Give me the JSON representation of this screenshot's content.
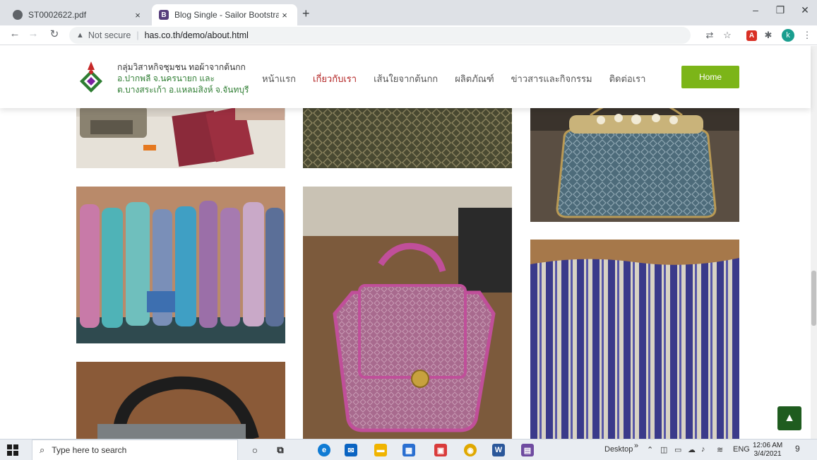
{
  "browser": {
    "tabs": [
      {
        "title": "ST0002622.pdf",
        "close": "×"
      },
      {
        "title": "Blog Single - Sailor Bootstrap Te",
        "close": "×"
      }
    ],
    "new_tab": "+",
    "window_controls": {
      "minimize": "–",
      "restore": "❐",
      "close": "✕"
    },
    "address": {
      "security": "Not secure",
      "url": "has.co.th/demo/about.html"
    },
    "profile_initial": "k"
  },
  "site": {
    "brand_lines": [
      "กลุ่มวิสาหกิจชุมชน ทอผ้าจากต้นกก",
      "อ.ปากพลี จ.นครนายก และ",
      "ต.บางสระเก้า อ.แหลมสิงห์ จ.จันทบุรี"
    ],
    "menu": [
      {
        "label": "หน้าแรก",
        "active": false
      },
      {
        "label": "เกี่ยวกับเรา",
        "active": true
      },
      {
        "label": "เส้นใยจากต้นกก",
        "active": false
      },
      {
        "label": "ผลิตภัณฑ์",
        "active": false
      },
      {
        "label": "ข่าวสารและกิจกรรม",
        "active": false
      },
      {
        "label": "ติดต่อเรา",
        "active": false
      }
    ],
    "home_button": "Home",
    "back_to_top_icon": "chevron-up-icon"
  },
  "colors": {
    "accent_green": "#7cb518",
    "active_menu": "#b22222",
    "back_to_top": "#1f5c1f"
  },
  "taskbar": {
    "search_placeholder": "Type here to search",
    "desktop_label": "Desktop",
    "chevrons": "»",
    "language": "ENG",
    "time": "12:06 AM",
    "date": "3/4/2021",
    "notification_count": "9"
  }
}
